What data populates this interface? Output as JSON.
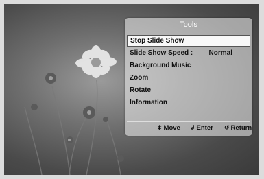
{
  "tools": {
    "title": "Tools",
    "items": [
      {
        "label": "Stop Slide Show",
        "value": ""
      },
      {
        "label": "Slide Show Speed :",
        "value": "Normal"
      },
      {
        "label": "Background Music",
        "value": ""
      },
      {
        "label": "Zoom",
        "value": ""
      },
      {
        "label": "Rotate",
        "value": ""
      },
      {
        "label": "Information",
        "value": ""
      }
    ],
    "selected_index": 0
  },
  "footer": {
    "move_label": "Move",
    "enter_label": "Enter",
    "return_label": "Return",
    "move_icon": "up-down-arrows-icon",
    "enter_icon": "enter-icon",
    "return_icon": "return-icon"
  }
}
